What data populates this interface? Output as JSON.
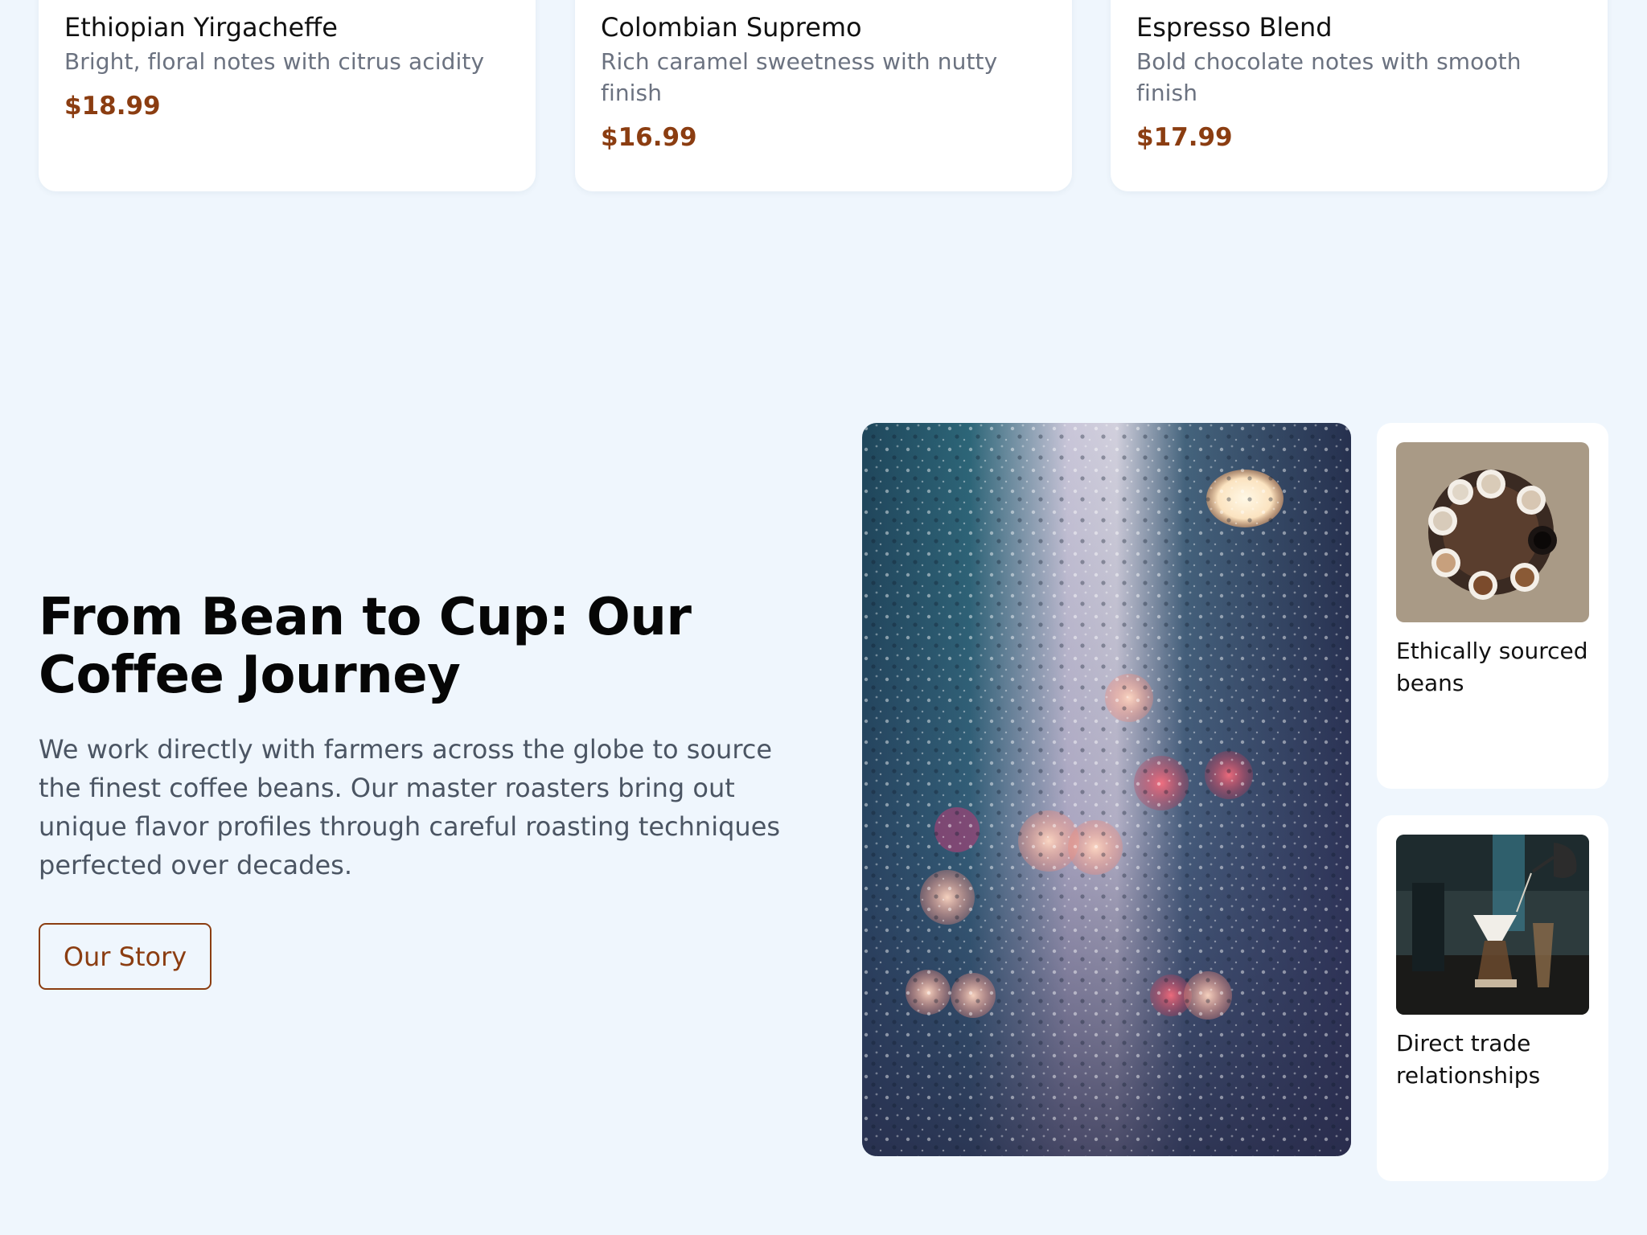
{
  "products": [
    {
      "name": "Ethiopian Yirgacheffe",
      "description": "Bright, floral notes with citrus acidity",
      "price": "$18.99"
    },
    {
      "name": "Colombian Supremo",
      "description": "Rich caramel sweetness with nutty finish",
      "price": "$16.99"
    },
    {
      "name": "Espresso Blend",
      "description": "Bold chocolate notes with smooth finish",
      "price": "$17.99"
    }
  ],
  "journey": {
    "title": "From Bean to Cup: Our Coffee Journey",
    "body": "We work directly with farmers across the globe to source the finest coffee beans. Our master roasters bring out unique flavor profiles through careful roasting techniques perfected over decades.",
    "button_label": "Our Story"
  },
  "features": [
    {
      "label": "Ethically sourced beans"
    },
    {
      "label": "Direct trade relationships"
    }
  ],
  "colors": {
    "page_background": "#eff6fd",
    "card_background": "#ffffff",
    "accent": "#8b3d11",
    "heading": "#060606",
    "body_text": "#4b5563",
    "muted_text": "#6b7280"
  }
}
